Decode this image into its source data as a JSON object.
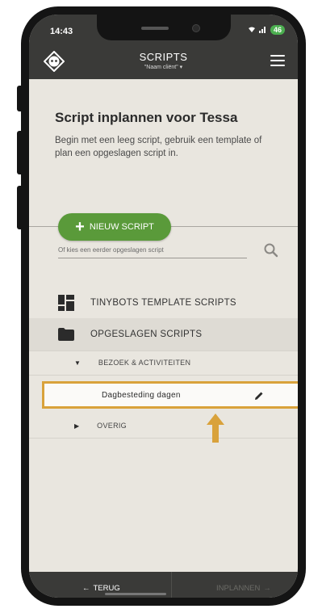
{
  "status_bar": {
    "time": "14:43",
    "battery": "46"
  },
  "app_bar": {
    "title": "SCRIPTS",
    "subtitle": "\"Naam cliënt\" ▾"
  },
  "header": {
    "title": "Script inplannen voor Tessa",
    "intro": "Begin met een leeg script, gebruik een template of plan een opgeslagen script in."
  },
  "new_script": {
    "label": "NIEUW SCRIPT"
  },
  "search": {
    "placeholder": "Of kies een eerder opgeslagen script"
  },
  "sections": {
    "templates": {
      "label": "TINYBOTS TEMPLATE SCRIPTS",
      "icon": "grid-icon"
    },
    "saved": {
      "label": "OPGESLAGEN SCRIPTS",
      "icon": "folder-icon"
    }
  },
  "categories": [
    {
      "label": "BEZOEK & ACTIVITEITEN",
      "expanded": true
    },
    {
      "label": "OVERIG",
      "expanded": false
    }
  ],
  "scripts": [
    {
      "name": "Dagbesteding dagen"
    }
  ],
  "footer": {
    "back": "TERUG",
    "plan": "INPLANNEN"
  },
  "colors": {
    "app_bar": "#3a3a38",
    "accent_green": "#5a9a3a",
    "highlight": "#d9a23b",
    "background": "#e9e6df"
  }
}
